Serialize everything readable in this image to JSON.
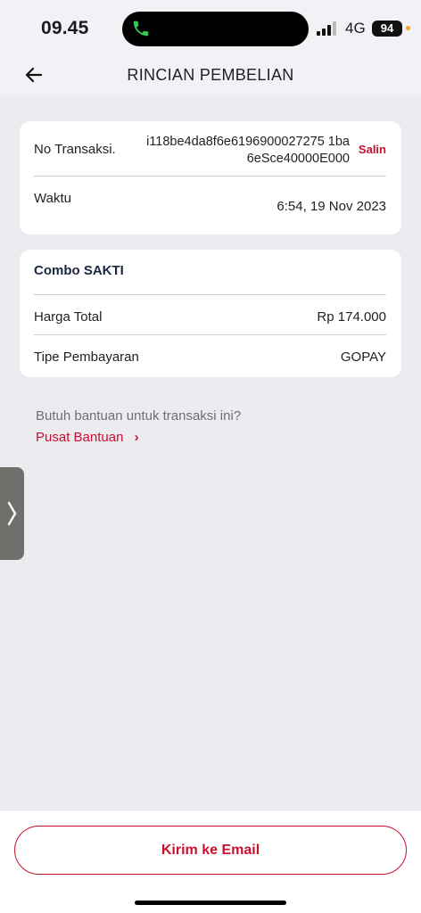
{
  "status": {
    "time": "09.45",
    "network": "4G",
    "battery": "94"
  },
  "header": {
    "title": "RINCIAN PEMBELIAN"
  },
  "transaction": {
    "id_label": "No Transaksi.",
    "id_value": "i118be4da8f6e6196900027275 1ba6eSce40000E000",
    "copy_label": "Salin",
    "time_label": "Waktu",
    "time_value": "6:54, 19 Nov 2023"
  },
  "purchase": {
    "product": "Combo SAKTI",
    "total_label": "Harga Total",
    "total_value": "Rp 174.000",
    "payment_label": "Tipe Pembayaran",
    "payment_value": "GOPAY"
  },
  "help": {
    "question": "Butuh bantuan untuk transaksi ini?",
    "link": "Pusat Bantuan",
    "chevron": "›"
  },
  "footer": {
    "email_button": "Kirim ke Email"
  },
  "colors": {
    "accent": "#c8102e",
    "background": "#ecebf0"
  },
  "icons": [
    "phone-icon",
    "back-arrow-icon",
    "chevron-right-icon",
    "signal-icon"
  ]
}
